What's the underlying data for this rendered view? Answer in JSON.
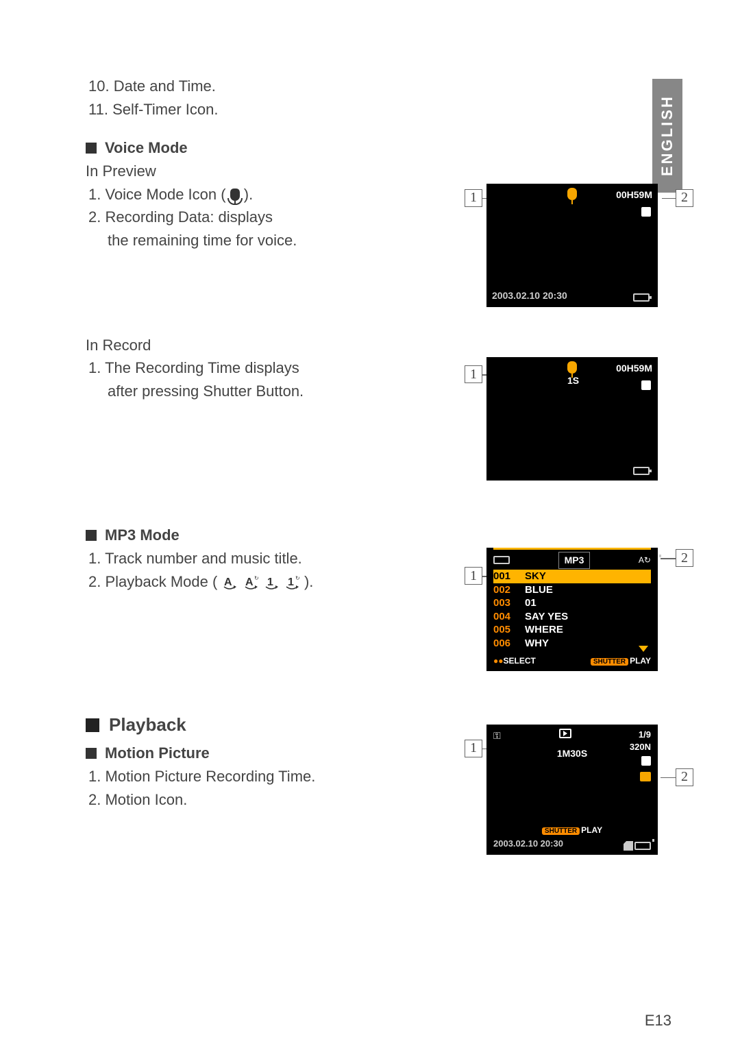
{
  "language_tab": "ENGLISH",
  "page_number": "E13",
  "top_items": [
    "10. Date and Time.",
    "11. Self-Timer Icon."
  ],
  "voice_mode": {
    "heading": "Voice Mode",
    "preview_label": "In Preview",
    "preview_items": {
      "1_prefix": "1.  Voice Mode Icon ( ",
      "1_suffix": " ).",
      "2a": "2.  Recording Data: displays",
      "2b": "the remaining time for voice."
    },
    "record_label": "In Record",
    "record_items": {
      "1a": "1.  The Recording Time displays",
      "1b": "after pressing Shutter Button."
    },
    "preview_screen": {
      "time_remaining": "00H59M",
      "datetime": "2003.02.10  20:30"
    },
    "record_screen": {
      "time_remaining": "00H59M",
      "elapsed": "1S"
    }
  },
  "mp3_mode": {
    "heading": "MP3 Mode",
    "items": {
      "1": "1.  Track number and music title.",
      "2_prefix": "2.  Playback Mode ( ",
      "2_suffix": " )."
    },
    "screen": {
      "header": "MP3",
      "tracks": [
        {
          "num": "001",
          "title": "SKY",
          "active": true
        },
        {
          "num": "002",
          "title": "BLUE"
        },
        {
          "num": "003",
          "title": "01"
        },
        {
          "num": "004",
          "title": "SAY YES"
        },
        {
          "num": "005",
          "title": "WHERE"
        },
        {
          "num": "006",
          "title": "WHY"
        }
      ],
      "footer_left": "SELECT",
      "footer_right_badge": "SHUTTER",
      "footer_right": "PLAY"
    }
  },
  "playback": {
    "heading": "Playback",
    "motion": {
      "heading": "Motion Picture",
      "items": {
        "1": "1.  Motion Picture Recording Time.",
        "2": "2.  Motion Icon."
      },
      "screen": {
        "counter": "1/9",
        "res": "320N",
        "center": "1M30S",
        "action_badge": "SHUTTER",
        "action": "PLAY",
        "datetime": "2003.02.10  20:30"
      }
    }
  },
  "callouts": {
    "c1": "1",
    "c2": "2"
  }
}
